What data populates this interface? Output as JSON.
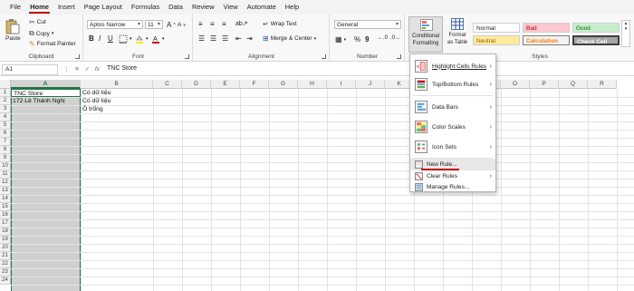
{
  "menu": {
    "tabs": [
      "File",
      "Home",
      "Insert",
      "Page Layout",
      "Formulas",
      "Data",
      "Review",
      "View",
      "Automate",
      "Help"
    ]
  },
  "ribbon": {
    "clipboard": {
      "paste": "Paste",
      "cut": "Cut",
      "copy": "Copy",
      "format_painter": "Format Painter",
      "label": "Clipboard"
    },
    "font": {
      "font_name": "Aptos Narrow",
      "font_size": "11",
      "bold": "B",
      "italic": "I",
      "underline": "U",
      "grow": "A",
      "shrink": "A",
      "label": "Font"
    },
    "alignment": {
      "wrap_text": "Wrap Text",
      "merge_center": "Merge & Center",
      "label": "Alignment"
    },
    "number": {
      "format": "General",
      "percent": "%",
      "comma": "9",
      "label": "Number"
    },
    "styles": {
      "conditional_formatting": "Conditional Formatting",
      "format_as_table": "Format as Table",
      "normal": "Normal",
      "bad": "Bad",
      "good": "Good",
      "neutral": "Neutral",
      "calculation": "Calculation",
      "check_cell": "Check Cell",
      "label": "Styles"
    }
  },
  "formula_bar": {
    "name_box": "A1",
    "fx": "fx",
    "content": "TNC Store"
  },
  "columns": [
    "A",
    "B",
    "C",
    "D",
    "E",
    "F",
    "G",
    "H",
    "I",
    "J",
    "K",
    "L",
    "M",
    "N",
    "O",
    "P",
    "Q",
    "R"
  ],
  "rows": [
    "1",
    "2",
    "3",
    "4",
    "5",
    "6",
    "7",
    "8",
    "9",
    "10",
    "11",
    "12",
    "13",
    "14",
    "15",
    "16",
    "17",
    "18",
    "19",
    "20",
    "21",
    "22",
    "23",
    "24"
  ],
  "cells": {
    "A1": "TNC Store",
    "A2": "172 Lê Thánh Nghị",
    "B1": "Có dữ liệu",
    "B2": "Có dữ liệu",
    "B3": "Ô trống"
  },
  "dropdown": {
    "items": [
      {
        "label": "Highlight Cells Rules",
        "submenu": true
      },
      {
        "label": "Top/Bottom Rules",
        "submenu": true
      },
      {
        "label": "Data Bars",
        "submenu": true
      },
      {
        "label": "Color Scales",
        "submenu": true
      },
      {
        "label": "Icon Sets",
        "submenu": true
      },
      {
        "label": "New Rule...",
        "submenu": false
      },
      {
        "label": "Clear Rules",
        "submenu": true
      },
      {
        "label": "Manage Rules...",
        "submenu": false
      }
    ]
  },
  "colors": {
    "accent_red": "#c00000",
    "excel_green": "#217346",
    "bad_bg": "#ffc7ce",
    "bad_fg": "#9c0006",
    "good_bg": "#c6efce",
    "good_fg": "#006100",
    "neutral_bg": "#ffeb9c",
    "neutral_fg": "#9c5700"
  }
}
